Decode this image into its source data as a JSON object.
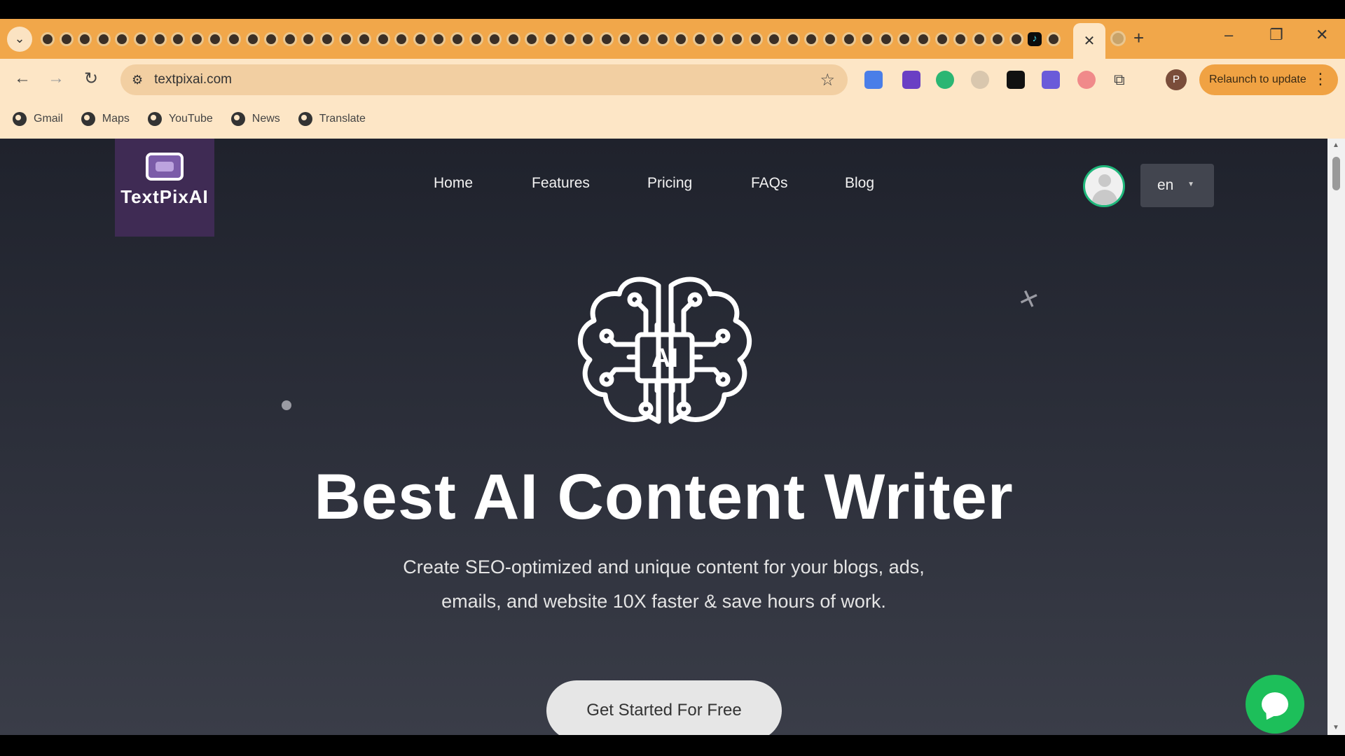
{
  "browser": {
    "tab_search_icon": "chevron-down-icon",
    "tab_count_visible": 55,
    "active_tab_close": "✕",
    "new_tab": "+",
    "window_controls": [
      "–",
      "❐",
      "✕"
    ],
    "address": "textpixai.com",
    "relaunch_label": "Relaunch to update",
    "profile_initial": "P",
    "bookmarks": [
      "Gmail",
      "Maps",
      "YouTube",
      "News",
      "Translate"
    ]
  },
  "site": {
    "logo_name": "TextPixAI",
    "nav": [
      "Home",
      "Features",
      "Pricing",
      "FAQs",
      "Blog"
    ],
    "lang": "en",
    "hero_title": "Best AI Content Writer",
    "hero_subtitle_line1": "Create SEO-optimized and unique content for your blogs, ads,",
    "hero_subtitle_line2": "emails, and website 10X faster & save hours of work.",
    "cta_label": "Get Started For Free",
    "brain_chip_text": "AI"
  },
  "colors": {
    "tabstrip": "#f1a74a",
    "toolbar": "#fde6c6",
    "page_bg": "#2b2d36",
    "chat_button": "#1dbf5a",
    "logo_bg": "#3f2b54"
  }
}
